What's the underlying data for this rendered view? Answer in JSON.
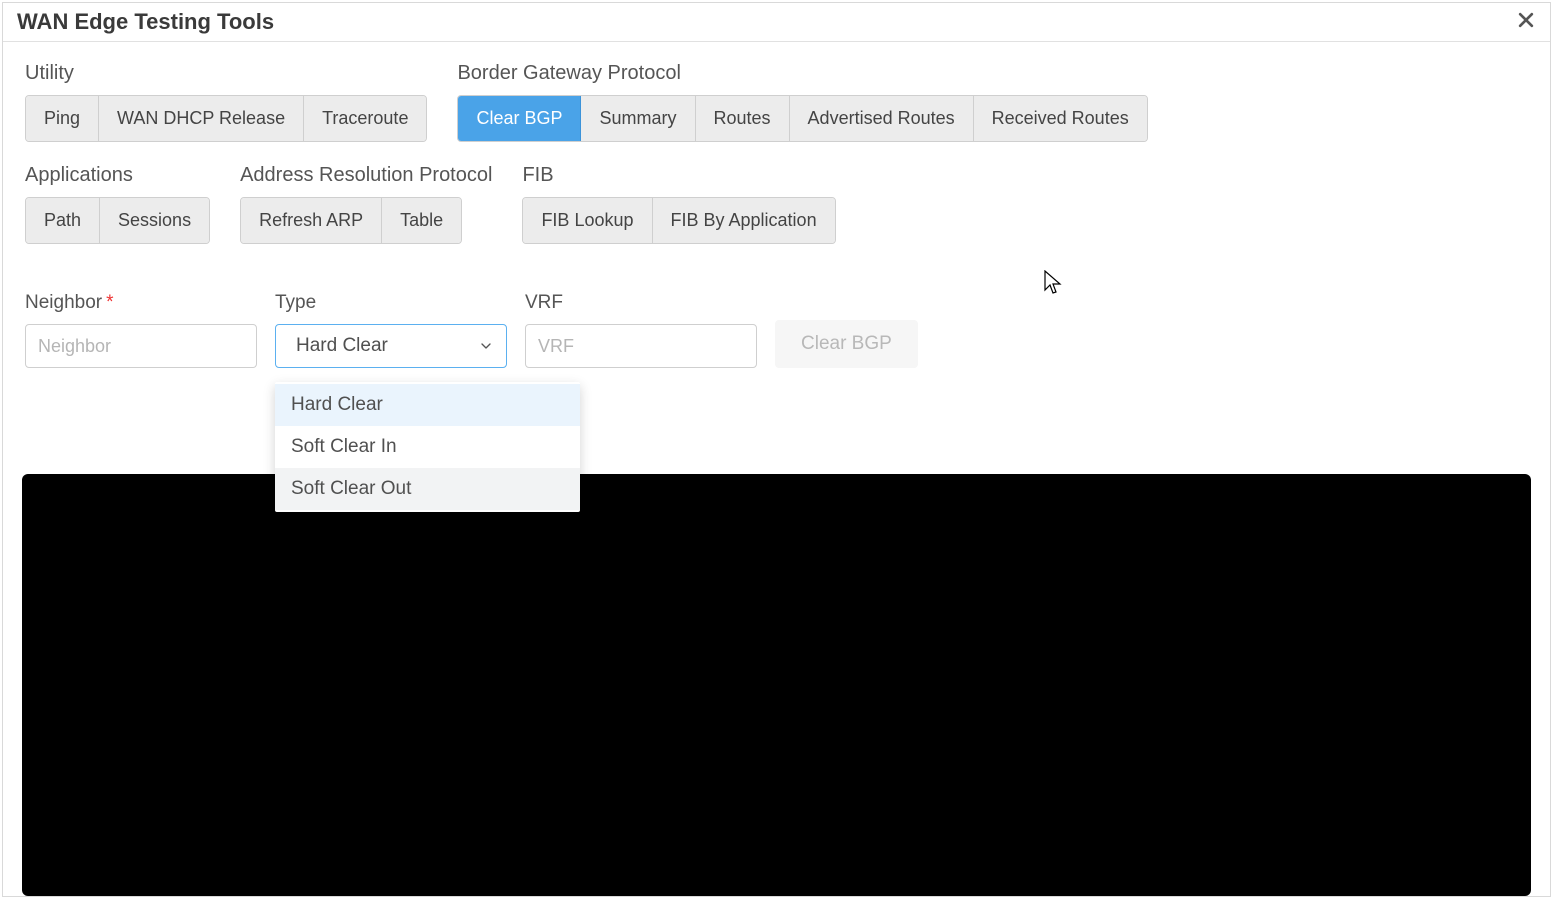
{
  "dialog": {
    "title": "WAN Edge Testing Tools"
  },
  "groups": {
    "utility": {
      "label": "Utility",
      "items": [
        "Ping",
        "WAN DHCP Release",
        "Traceroute"
      ]
    },
    "bgp": {
      "label": "Border Gateway Protocol",
      "items": [
        "Clear BGP",
        "Summary",
        "Routes",
        "Advertised Routes",
        "Received Routes"
      ],
      "active_index": 0
    },
    "applications": {
      "label": "Applications",
      "items": [
        "Path",
        "Sessions"
      ]
    },
    "arp": {
      "label": "Address Resolution Protocol",
      "items": [
        "Refresh ARP",
        "Table"
      ]
    },
    "fib": {
      "label": "FIB",
      "items": [
        "FIB Lookup",
        "FIB By Application"
      ]
    }
  },
  "form": {
    "neighbor": {
      "label": "Neighbor",
      "required_mark": "*",
      "placeholder": "Neighbor",
      "value": ""
    },
    "type": {
      "label": "Type",
      "selected": "Hard Clear",
      "options": [
        "Hard Clear",
        "Soft Clear In",
        "Soft Clear Out"
      ],
      "hover_index": 2,
      "selected_index": 0
    },
    "vrf": {
      "label": "VRF",
      "placeholder": "VRF",
      "value": ""
    },
    "action": {
      "label": "Clear BGP",
      "disabled": true
    }
  }
}
